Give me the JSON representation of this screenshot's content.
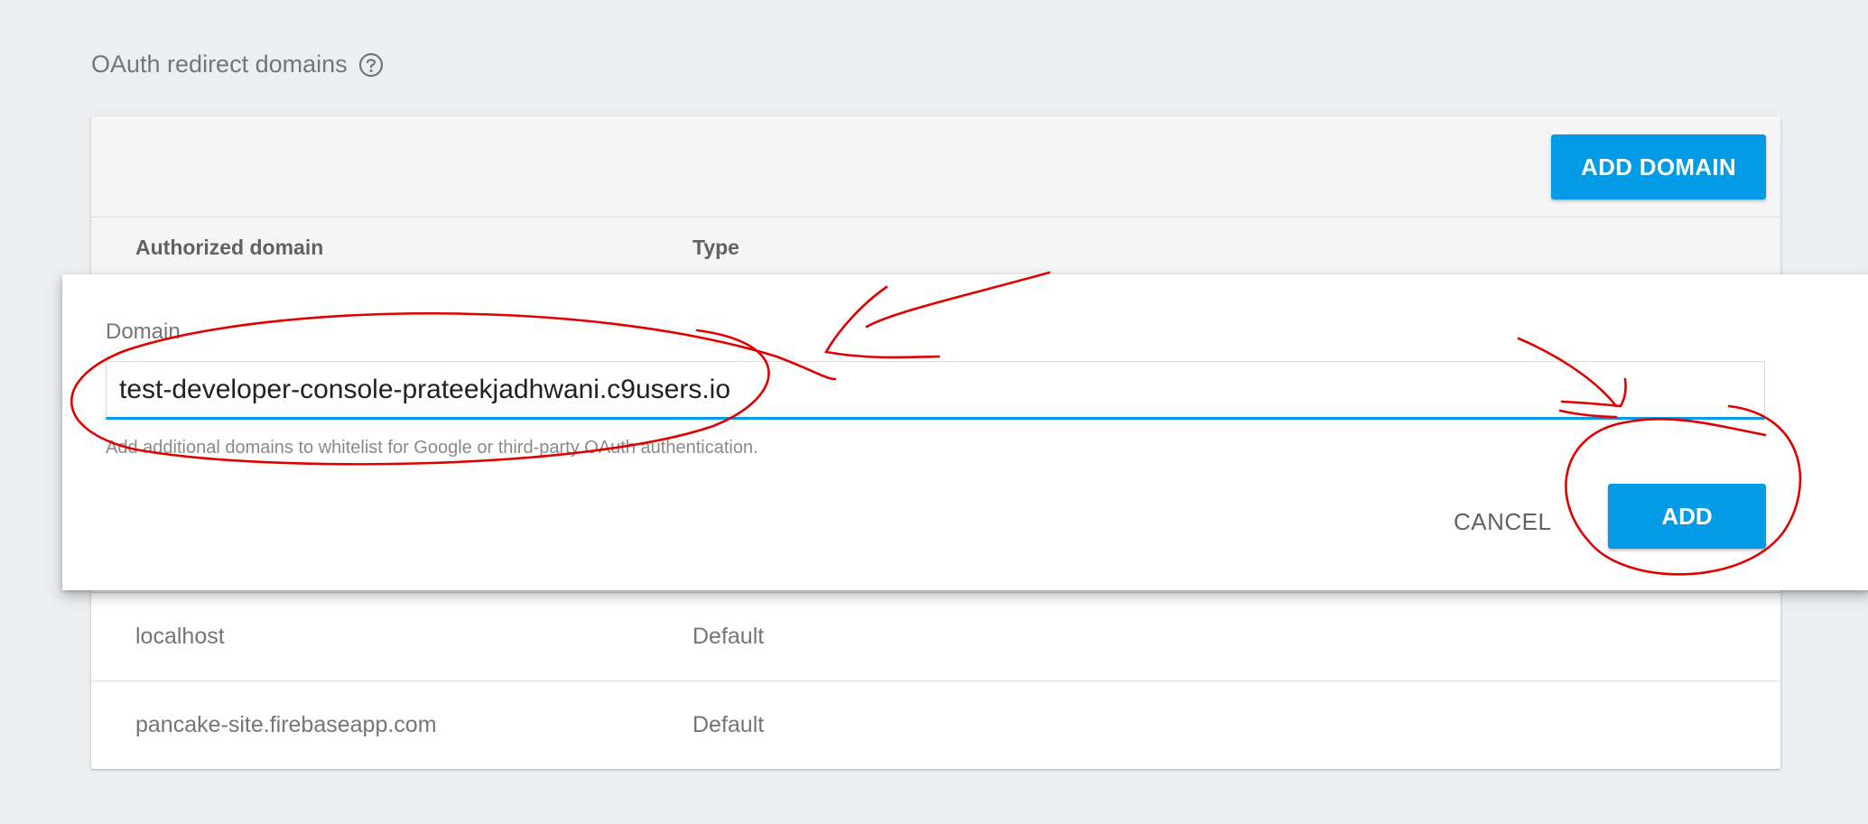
{
  "section": {
    "title": "OAuth redirect domains",
    "help_icon": "help-circle-icon"
  },
  "toolbar": {
    "add_domain_label": "ADD DOMAIN"
  },
  "table": {
    "columns": [
      "Authorized domain",
      "Type"
    ],
    "rows": [
      {
        "domain": "localhost",
        "type": "Default"
      },
      {
        "domain": "pancake-site.firebaseapp.com",
        "type": "Default"
      }
    ]
  },
  "dialog": {
    "field_label": "Domain",
    "input_value": "test-developer-console-prateekjadhwani.c9users.io",
    "hint": "Add additional domains to whitelist for Google or third-party OAuth authentication.",
    "cancel_label": "CANCEL",
    "add_label": "ADD"
  },
  "colors": {
    "accent": "#039be5",
    "annotation": "#e00000",
    "background": "#eceff1"
  }
}
